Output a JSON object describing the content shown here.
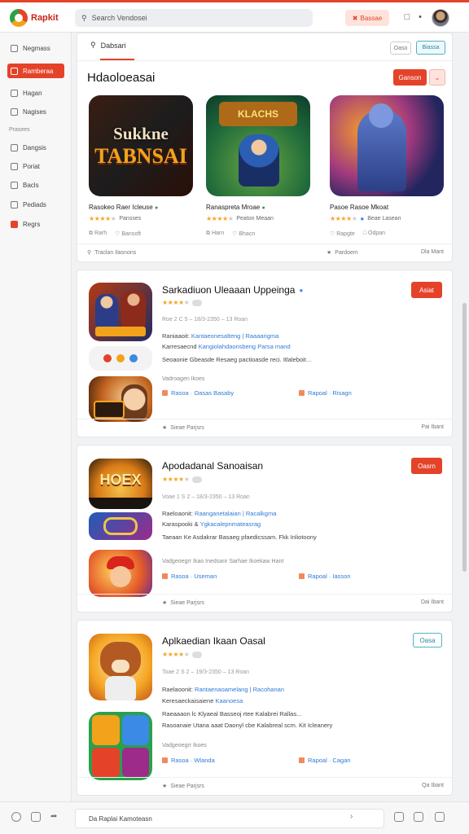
{
  "topbar": {
    "app_name": "Rapkit",
    "search_placeholder": "Search Vendosei",
    "action_label": "Bassae",
    "colors": {
      "accent": "#e4432a",
      "brand_green": "#2aa14b"
    }
  },
  "sidebar": {
    "items": [
      {
        "label": "Negmass",
        "icon": "home-icon"
      },
      {
        "label": "Ramberaa",
        "icon": "grid-icon",
        "active": true
      },
      {
        "label": "Hagan",
        "icon": "layers-icon"
      },
      {
        "label": "Nagises",
        "icon": "chart-icon"
      }
    ],
    "section_label": "Prasees",
    "items2": [
      {
        "label": "Dangsis",
        "icon": "list-icon"
      },
      {
        "label": "Poriat",
        "icon": "user-icon"
      },
      {
        "label": "Bacls",
        "icon": "doc-icon"
      },
      {
        "label": "Pediads",
        "icon": "mail-icon"
      },
      {
        "label": "Regrs",
        "icon": "flag-icon",
        "red": true
      }
    ]
  },
  "featured": {
    "tab_label": "Dabsari",
    "pill_1": "Oaso",
    "pill_2": "Biassa",
    "title": "Hdaoloeasai",
    "action_label": "Ganson",
    "cards": [
      {
        "art_text_1": "Sukkne",
        "art_text_2": "TABNSAI",
        "name": "Rasokeo Raer Icleuse",
        "rating_text": "Pansses",
        "meta_1": "Rarh",
        "meta_2": "Bansoft"
      },
      {
        "art_text": "KLACHS",
        "name": "Ranaspreta Mroae",
        "rating_text": "Peaton Meaan",
        "meta_1": "Harn",
        "meta_2": "Bhacn"
      },
      {
        "name": "Pasoe Rasoe Mkoat",
        "rating_text": "Beae Lasean",
        "meta_1": "Rapgte",
        "meta_2": "Odpan"
      }
    ],
    "foot_left": "Traclan Ilasnons",
    "foot_right": "Pardoem",
    "foot_far_right": "Dla Mant"
  },
  "apps": [
    {
      "title": "Sarkadiuon Uleaaan Uppeinga",
      "button": "Asiat",
      "date": "Roe 2 C 5 – 18/3-2350 – 13 Roan",
      "line1_label": "Raniaaoit:",
      "line1_link": "Kantaeonesalteng | Raaaarigma",
      "line2_label": "Karresaecnd",
      "line2_link": "Kangiolahdaonsbeng Parsa mand",
      "line3": "Seoaonie Gbeasde Resaeg pactioasde reci. Itlaleboit…",
      "meta": "Vadroagen Ikoes",
      "link_1": "Rasoa · Oasas Basaby",
      "link_2": "Rapoal · Risagn",
      "foot_left": "Sieae Parjsrs",
      "foot_right": "Pai Ibant"
    },
    {
      "title": "Apodadanal Sanoaisan",
      "button": "Oasrn",
      "date": "Voae 1 S 2 – 18/3-2350 – 13 Roan",
      "line1_label": "Raeloaonit:",
      "line1_link": "Raanganetalaian | Racalkgma",
      "line2_label": "Karaspooki &",
      "line2_link": "Ygkacalepnmateasrag",
      "line3": "Taeaan Ke Asdakrar Basaeg pfaedicssam. Fkk Inliotoony",
      "meta": "Vadgeoegrr Ikao Inedsanr Sarhae Ikoekaw Hant",
      "link_1": "Rasoa · Useman",
      "link_2": "Rapoal · Iasson",
      "foot_left": "Sieae Parjsrs",
      "foot_right": "Dai Ibant"
    },
    {
      "title": "Aplkaedian Ikaan Oasal",
      "button": "Oasa",
      "date": "Toae 2 S 2 – 19/3-2350 – 13 Roan",
      "line1_label": "Raelaoonit:",
      "line1_link": "Rantaenaoamelang | Racohanan",
      "line2_label": "Keresaeckaisaiene",
      "line2_link": "Kaanoesa",
      "line3": "Raeaaaon lc Klyaeal Basseoj rtee Kalabrei Rallas...",
      "line4": "Rasoanaie Utana aaat Daonyl cbe Kalabreal scm. Kit Icleanery",
      "meta": "Vadgeoegrr Ikoes",
      "link_1": "Rasoa · Wlanda",
      "link_2": "Rapoal · Cagan",
      "foot_left": "Sieae Parjsrs",
      "foot_right": "Qa Ibant"
    }
  ],
  "bottombar": {
    "input_text": "Da Raplai Kamoteasn"
  }
}
